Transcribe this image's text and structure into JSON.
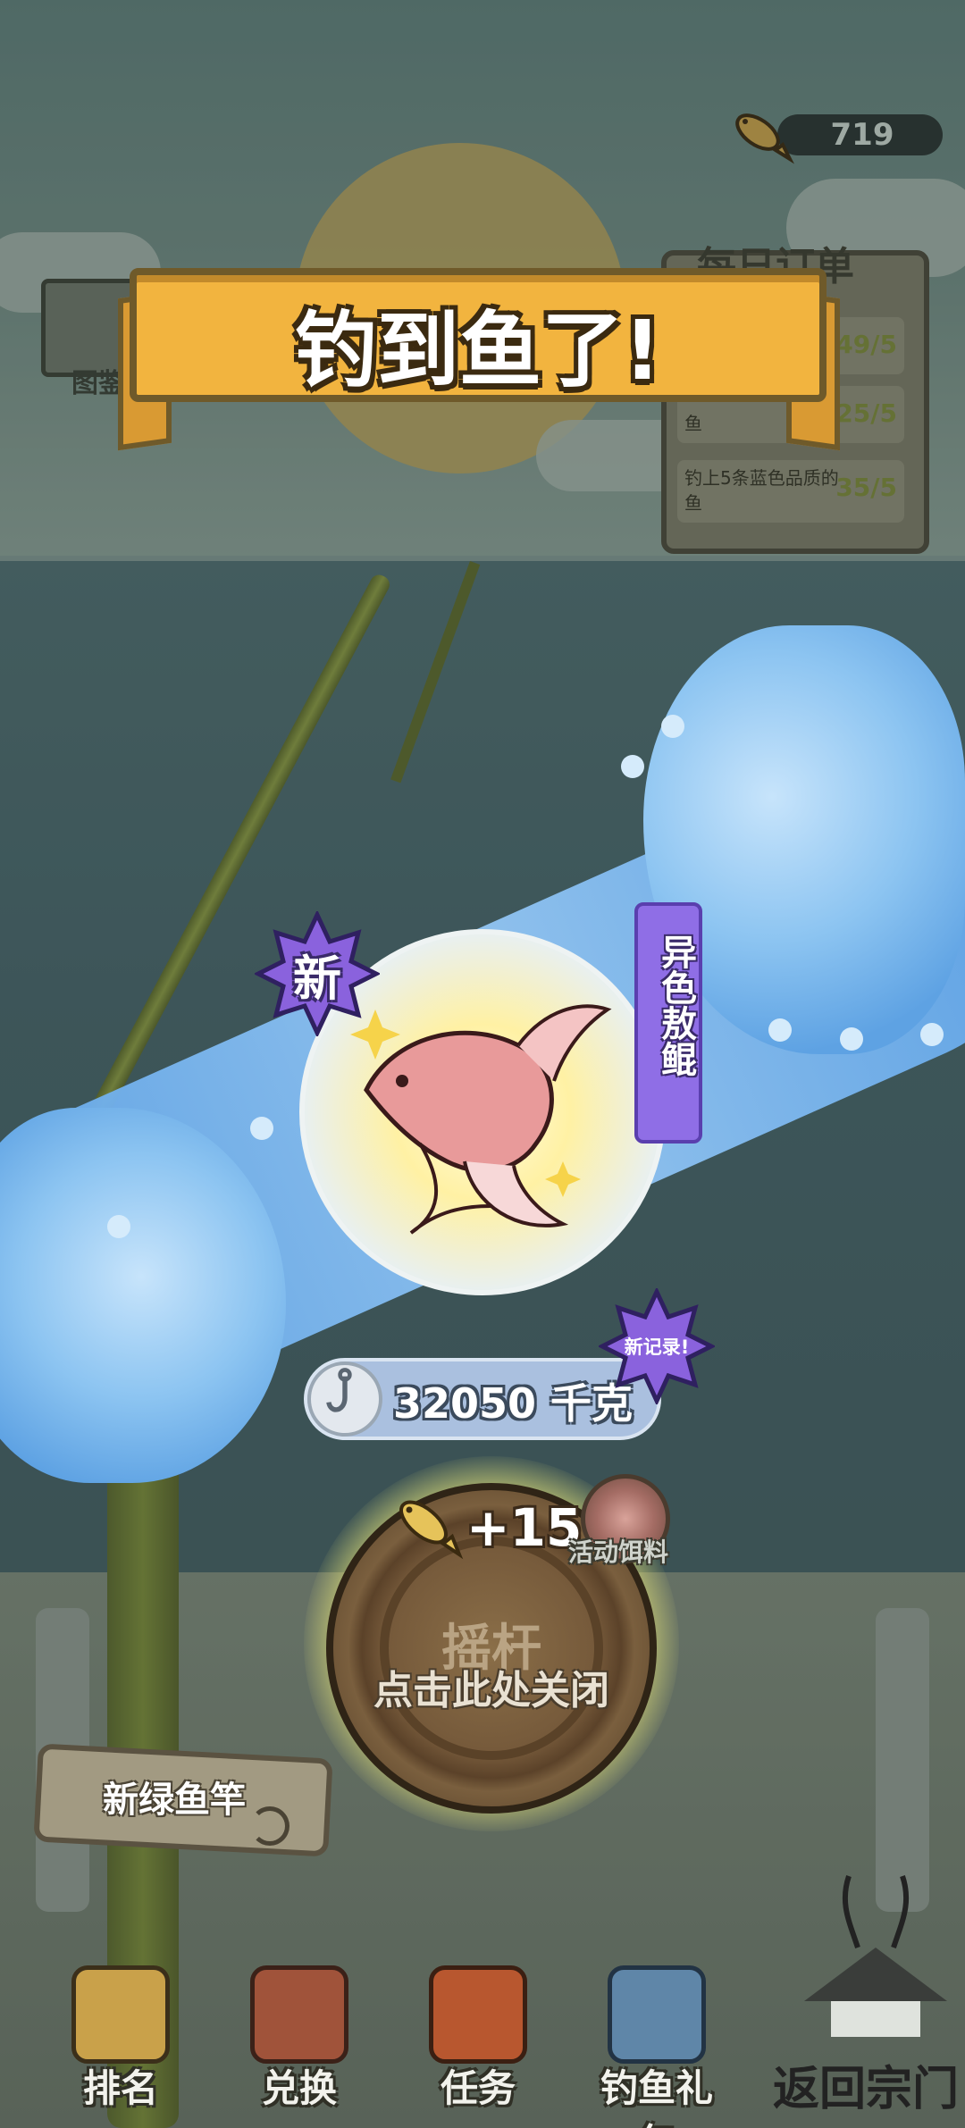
{
  "currency": {
    "value": "719",
    "icon": "fish-coin-icon"
  },
  "atlas": {
    "label": "图鉴"
  },
  "daily_orders": {
    "title": "每日订单",
    "rows": [
      {
        "text": "",
        "progress": "49/5"
      },
      {
        "text": "鱼",
        "progress": "25/5"
      },
      {
        "text": "钓上5条蓝色品质的鱼",
        "progress": "35/5"
      }
    ]
  },
  "result": {
    "title": "钓到鱼了!",
    "new_badge": "新",
    "fish_name": "异色敖鲲",
    "weight": "32050 千克",
    "record_badge": "新记录!",
    "reward": "+15",
    "bait_label": "活动饵料"
  },
  "reel": {
    "label": "摇杆",
    "close_hint": "点击此处关闭"
  },
  "rod": {
    "name": "新绿鱼竿"
  },
  "nav": {
    "items": [
      {
        "label": "排名",
        "icon": "ranking-icon"
      },
      {
        "label": "兑换",
        "icon": "treasure-chest-icon"
      },
      {
        "label": "任务",
        "icon": "task-book-icon"
      },
      {
        "label": "钓鱼礼包",
        "icon": "fishing-gift-icon"
      }
    ],
    "return_label": "返回宗门"
  },
  "colors": {
    "banner": "#f2b43f",
    "name_tag": "#8f6ee6",
    "wave": "#8cc4f1",
    "weight_pill": "#aac0df"
  }
}
